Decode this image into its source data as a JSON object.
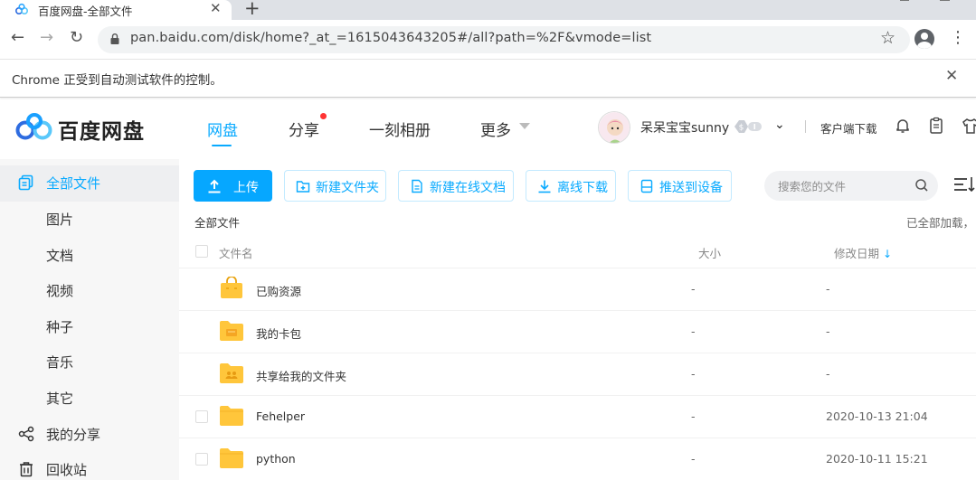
{
  "browser": {
    "tab_title": "百度网盘-全部文件",
    "url": "pan.baidu.com/disk/home?_at_=1615043643205#/all?path=%2F&vmode=list",
    "info_bar": "Chrome 正受到自动测试软件的控制。"
  },
  "header": {
    "logo_text": "百度网盘",
    "nav": [
      {
        "label": "网盘",
        "active": true
      },
      {
        "label": "分享",
        "badge_dot": true
      },
      {
        "label": "一刻相册"
      },
      {
        "label": "更多"
      }
    ],
    "username": "呆呆宝宝sunny",
    "client_download": "客户端下载"
  },
  "sidebar": {
    "items": [
      {
        "label": "全部文件",
        "icon": "files-icon",
        "active": true
      },
      {
        "label": "图片"
      },
      {
        "label": "文档"
      },
      {
        "label": "视频"
      },
      {
        "label": "种子"
      },
      {
        "label": "音乐"
      },
      {
        "label": "其它"
      },
      {
        "label": "我的分享",
        "icon": "share-icon"
      },
      {
        "label": "回收站",
        "icon": "trash-icon"
      }
    ]
  },
  "toolbar": {
    "upload": "上传",
    "new_folder": "新建文件夹",
    "new_doc": "新建在线文档",
    "offline_download": "离线下载",
    "push_device": "推送到设备",
    "search_placeholder": "搜索您的文件"
  },
  "breadcrumb": "全部文件",
  "load_status": "已全部加载，",
  "list": {
    "columns": {
      "name": "文件名",
      "size": "大小",
      "modified": "修改日期"
    },
    "rows": [
      {
        "name": "已购资源",
        "size": "-",
        "date": "-",
        "icon": "purchased-folder-icon"
      },
      {
        "name": "我的卡包",
        "size": "-",
        "date": "-",
        "icon": "card-folder-icon"
      },
      {
        "name": "共享给我的文件夹",
        "size": "-",
        "date": "-",
        "icon": "shared-folder-icon"
      },
      {
        "name": "Fehelper",
        "size": "-",
        "date": "2020-10-13 21:04",
        "icon": "folder-icon"
      },
      {
        "name": "python",
        "size": "-",
        "date": "2020-10-11 15:21",
        "icon": "folder-icon"
      }
    ]
  },
  "colors": {
    "accent": "#09aaff",
    "folder": "#ffc63b"
  }
}
